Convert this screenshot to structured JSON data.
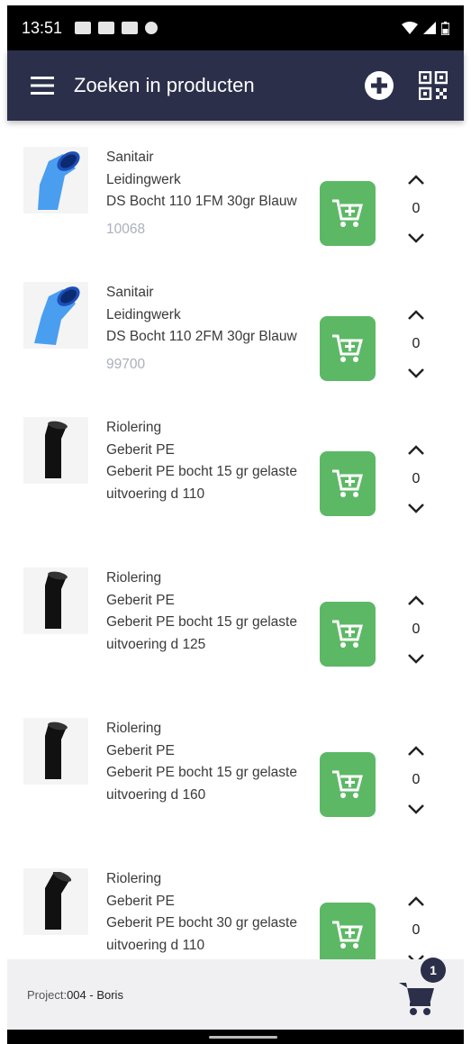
{
  "status_bar": {
    "time": "13:51"
  },
  "toolbar": {
    "title": "Zoeken in producten"
  },
  "products": [
    {
      "category": "Sanitair",
      "subcategory": "Leidingwerk",
      "name": "DS Bocht 110 1FM 30gr Blauw",
      "code": "10068",
      "quantity": "0",
      "image": "blue-pipe-bend"
    },
    {
      "category": "Sanitair",
      "subcategory": "Leidingwerk",
      "name": "DS Bocht 110 2FM 30gr Blauw",
      "code": "99700",
      "quantity": "0",
      "image": "blue-pipe-bend"
    },
    {
      "category": "Riolering",
      "subcategory": "Geberit PE",
      "name": "Geberit PE bocht 15 gr gelaste uitvoering d 110",
      "code": "",
      "quantity": "0",
      "image": "black-pipe-bend"
    },
    {
      "category": "Riolering",
      "subcategory": "Geberit PE",
      "name": "Geberit PE bocht 15 gr gelaste uitvoering d 125",
      "code": "",
      "quantity": "0",
      "image": "black-pipe-bend"
    },
    {
      "category": "Riolering",
      "subcategory": "Geberit PE",
      "name": "Geberit PE bocht 15 gr gelaste uitvoering d 160",
      "code": "",
      "quantity": "0",
      "image": "black-pipe-bend"
    },
    {
      "category": "Riolering",
      "subcategory": "Geberit PE",
      "name": "Geberit PE bocht 30 gr gelaste uitvoering d 110",
      "code": "",
      "quantity": "0",
      "image": "black-pipe-bend"
    }
  ],
  "footer": {
    "project_label": "Project:",
    "project_value": "004 - Boris",
    "cart_count": "1"
  },
  "colors": {
    "toolbar": "#2b2f4a",
    "add_button": "#5cb865",
    "code_text": "#aab0bb"
  }
}
